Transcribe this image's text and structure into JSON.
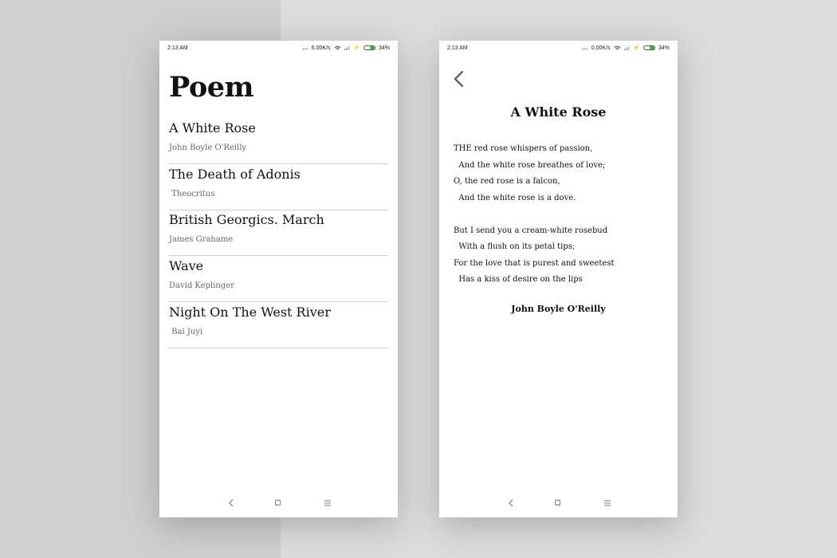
{
  "status_left": {
    "time": "2:13 AM",
    "dots": "...",
    "speed": "6.00K/s",
    "battery": "34%"
  },
  "status_right": {
    "time": "2:13 AM",
    "dots": "...",
    "speed": "0.00K/s",
    "battery": "34%"
  },
  "list_screen": {
    "title": "Poem",
    "items": [
      {
        "title": "A White Rose",
        "author": "John Boyle O'Reilly"
      },
      {
        "title": "The Death of Adonis",
        "author": " Theocritus"
      },
      {
        "title": "British Georgics. March",
        "author": "James Grahame"
      },
      {
        "title": "Wave",
        "author": "David Keplinger"
      },
      {
        "title": "Night On The West River",
        "author": " Bai Juyi"
      }
    ]
  },
  "detail_screen": {
    "title": "A White Rose",
    "stanza1": [
      "THE red rose whispers of passion,",
      "  And the white rose breathes of love;",
      "O, the red rose is a falcon,",
      "  And the white rose is a dove."
    ],
    "stanza2": [
      "But I send you a cream-white rosebud",
      "  With a flush on its petal tips;",
      "For the love that is purest and sweetest",
      "  Has a kiss of desire on the lips"
    ],
    "author": "John Boyle O'Reilly"
  }
}
